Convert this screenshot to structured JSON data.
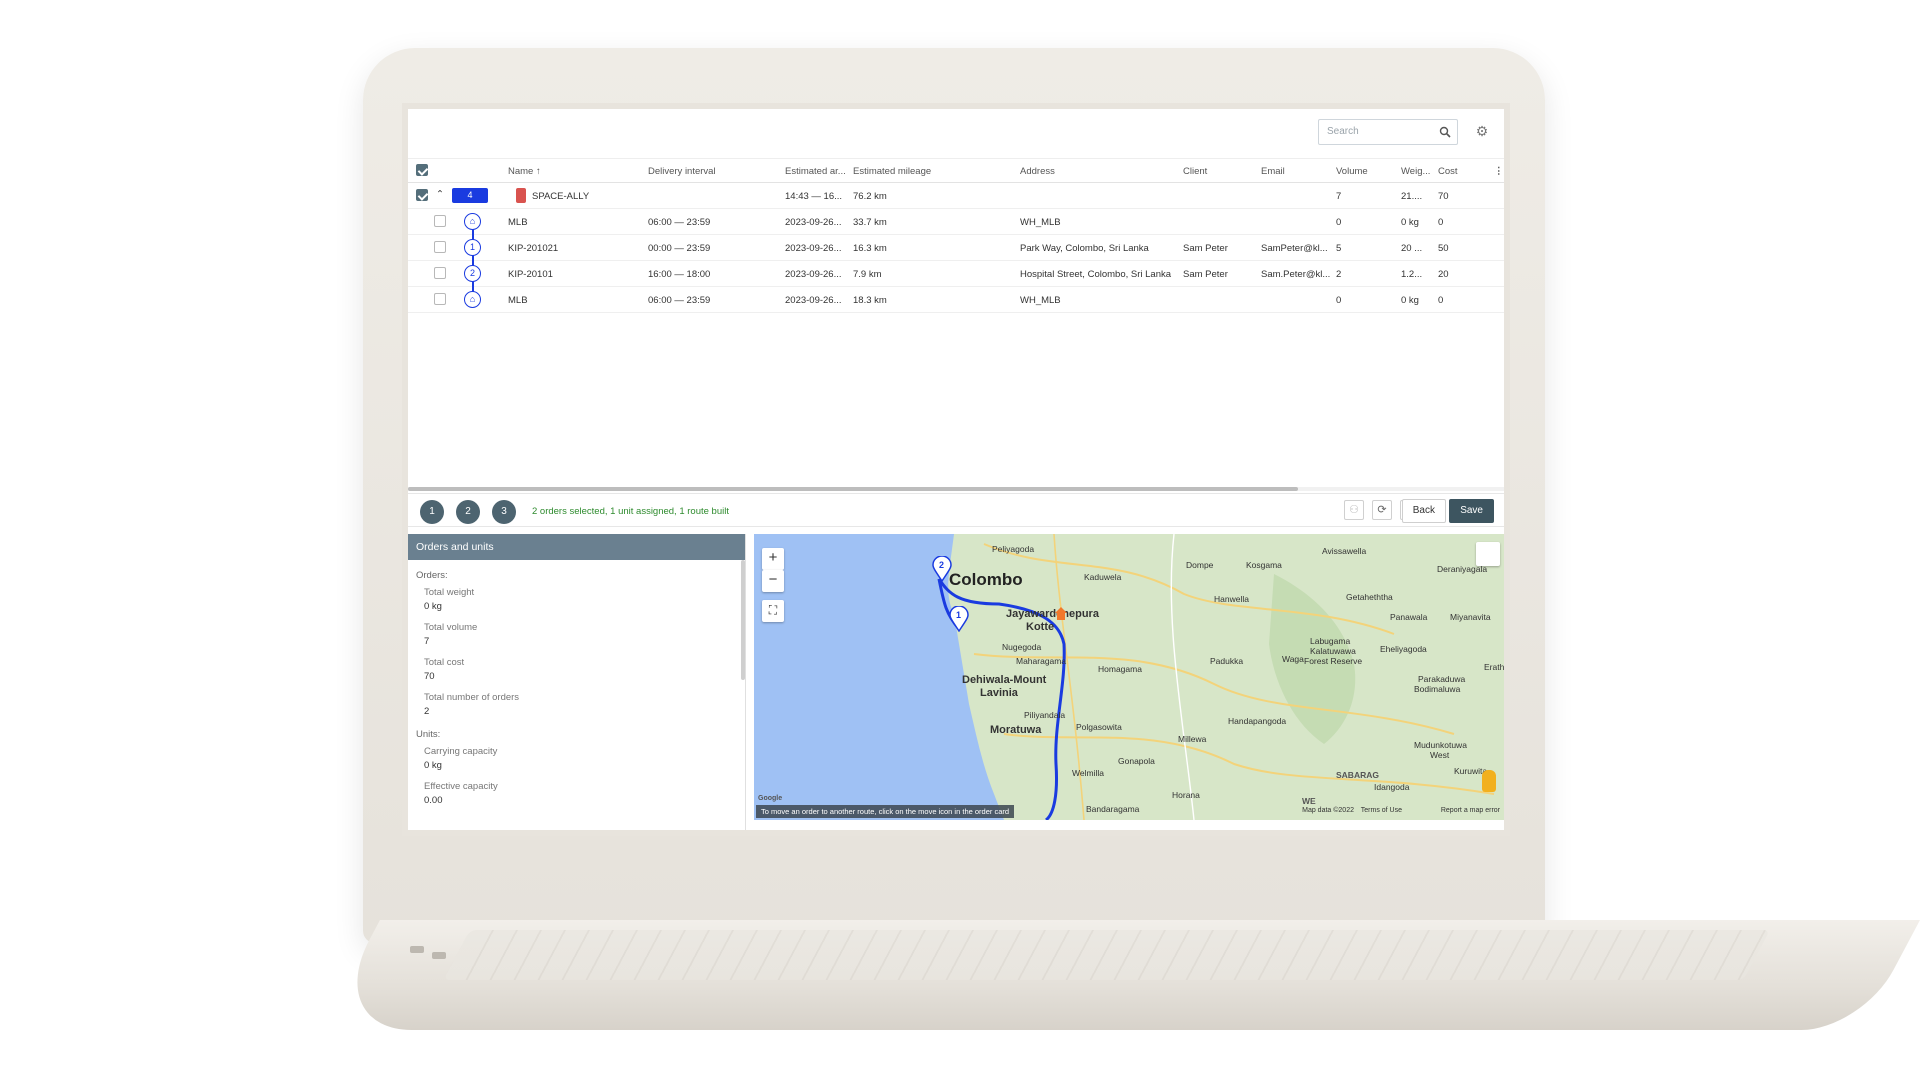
{
  "search": {
    "placeholder": "Search"
  },
  "table": {
    "headers": {
      "name": "Name ↑",
      "delivery_interval": "Delivery interval",
      "estimated_arrival": "Estimated ar...",
      "estimated_mileage": "Estimated mileage",
      "address": "Address",
      "client": "Client",
      "email": "Email",
      "volume": "Volume",
      "weight": "Weig...",
      "cost": "Cost"
    },
    "unit_row": {
      "count_badge": "4",
      "name": "SPACE-ALLY",
      "arrival": "14:43 — 16...",
      "mileage": "76.2 km",
      "volume": "7",
      "weight": "21....",
      "cost": "70"
    },
    "rows": [
      {
        "stop": "⌂",
        "name": "MLB",
        "interval": "06:00 — 23:59",
        "arrival": "2023-09-26...",
        "mileage": "33.7 km",
        "address": "WH_MLB",
        "client": "",
        "email": "",
        "volume": "0",
        "weight": "0 kg",
        "cost": "0"
      },
      {
        "stop": "1",
        "name": "KIP-201021",
        "interval": "00:00 — 23:59",
        "arrival": "2023-09-26...",
        "mileage": "16.3 km",
        "address": "Park Way, Colombo, Sri Lanka",
        "client": "Sam Peter",
        "email": "SamPeter@kl...",
        "volume": "5",
        "weight": "20 ...",
        "cost": "50"
      },
      {
        "stop": "2",
        "name": "KIP-20101",
        "interval": "16:00 — 18:00",
        "arrival": "2023-09-26...",
        "mileage": "7.9 km",
        "address": "Hospital Street, Colombo, Sri Lanka",
        "client": "Sam Peter",
        "email": "Sam.Peter@kl...",
        "volume": "2",
        "weight": "1.2...",
        "cost": "20"
      },
      {
        "stop": "⌂",
        "name": "MLB",
        "interval": "06:00 — 23:59",
        "arrival": "2023-09-26...",
        "mileage": "18.3 km",
        "address": "WH_MLB",
        "client": "",
        "email": "",
        "volume": "0",
        "weight": "0 kg",
        "cost": "0"
      }
    ]
  },
  "steps": [
    "1",
    "2",
    "3"
  ],
  "status_text": "2 orders selected, 1 unit assigned, 1 route built",
  "buttons": {
    "back": "Back",
    "save": "Save"
  },
  "panel": {
    "title": "Orders and units",
    "orders_label": "Orders:",
    "total_weight_label": "Total weight",
    "total_weight": "0 kg",
    "total_volume_label": "Total volume",
    "total_volume": "7",
    "total_cost_label": "Total cost",
    "total_cost": "70",
    "total_orders_label": "Total number of orders",
    "total_orders": "2",
    "units_label": "Units:",
    "carrying_capacity_label": "Carrying capacity",
    "carrying_capacity": "0 kg",
    "effective_capacity_label": "Effective capacity",
    "effective_capacity": "0.00"
  },
  "map": {
    "labels": {
      "colombo": "Colombo",
      "jayawardenepura": "Jayawardenepura",
      "kotte": "Kotte",
      "dehiwala": "Dehiwala-Mount",
      "lavinia": "Lavinia",
      "moratuwa": "Moratuwa",
      "peliyagoda": "Peliyagoda",
      "kaduwela": "Kaduwela",
      "dompe": "Dompe",
      "kosgama": "Kosgama",
      "avissawella": "Avissawella",
      "deraniyagala": "Deraniyagala",
      "nugegoda": "Nugegoda",
      "maharagama": "Maharagama",
      "homagama": "Homagama",
      "padukka": "Padukka",
      "waga": "Waga",
      "getaheththa": "Getaheththa",
      "panawala": "Panawala",
      "miyanavita": "Miyanavita",
      "labugama": "Labugama",
      "kalatuwawa": "Kalatuwawa",
      "forest_reserve": "Forest Reserve",
      "eheliyagoda": "Eheliyagoda",
      "parakaduwa": "Parakaduwa",
      "bodimaluwa": "Bodimaluwa",
      "piliyandala": "Piliyandala",
      "polgasowita": "Polgasowita",
      "handapangoda": "Handapangoda",
      "millewa": "Millewa",
      "gonapola": "Gonapola",
      "welmilla": "Welmilla",
      "horana": "Horana",
      "bandaragama": "Bandaragama",
      "idangoda": "Idangoda",
      "kuruwita": "Kuruwita",
      "mudunkotuwa": "Mudunkotuwa",
      "mudunkotuwa_west": "West",
      "sabarag": "SABARAG",
      "we": "WE",
      "erath": "Erath",
      "hanwella": "Hanwella"
    },
    "pin_1": "1",
    "pin_2": "2",
    "zoom_in": "+",
    "zoom_out": "−",
    "fullscreen": "⛶",
    "hint": "To move an order to another route, click on the move icon in the order card",
    "attribution": "Map data ©2022",
    "terms": "Terms of Use",
    "report": "Report a map error",
    "google": "Google"
  },
  "colors": {
    "route": "#1a3be0",
    "save_button": "#3d5560",
    "status_green": "#2e8b2e",
    "water": "#9fc1f4",
    "land": "#d7e6c8"
  }
}
